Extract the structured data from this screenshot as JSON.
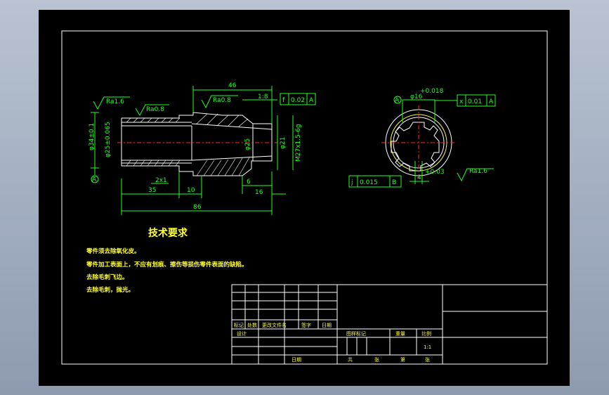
{
  "drawing": {
    "dims": {
      "d46": "46",
      "taper": "1:8",
      "ra16": "Ra1.6",
      "ra08a": "Ra0.8",
      "ra08b": "Ra0.8",
      "phi34": "φ34±0.1",
      "phi25": "φ25±0.065",
      "phi25b": "φ25",
      "phi21": "φ21",
      "m27": "M27x1.5-6g",
      "len35": "35",
      "len10": "10",
      "len86": "86",
      "len16": "16",
      "len6": "6",
      "chamfer": "2x1",
      "datumA": "A"
    },
    "tol1": {
      "sym": "f",
      "val": "0.02",
      "ref": "A"
    },
    "section": {
      "phi16": "φ16",
      "tol_top": "+0.018",
      "tol_top2": "0",
      "tol2": {
        "sym": "x",
        "val": "0.01",
        "ref": "A"
      },
      "tol3": {
        "sym": "j",
        "val": "0.015",
        "ref": "B"
      },
      "ra16": "Ra1.6",
      "w4": "4",
      "w4tol": "+0.03",
      "datumA": "A"
    }
  },
  "requirements": {
    "title": "技术要求",
    "items": [
      "零件须去除氧化皮。",
      "零件加工表面上，不应有划痕、擦伤等损伤零件表面的缺陷。",
      "去除毛刺飞边。",
      "去除毛刺，抛光。"
    ]
  },
  "title_block": {
    "row_labels": [
      "标记",
      "处数",
      "更改文件名",
      "签字",
      "日期"
    ],
    "design": "设计",
    "stage": "图样标记",
    "weight": "重量",
    "scale": "比例",
    "scale_val": "1:1",
    "date": "日期",
    "total": "共",
    "sheet": "张",
    "page": "第",
    "sheet2": "张"
  }
}
